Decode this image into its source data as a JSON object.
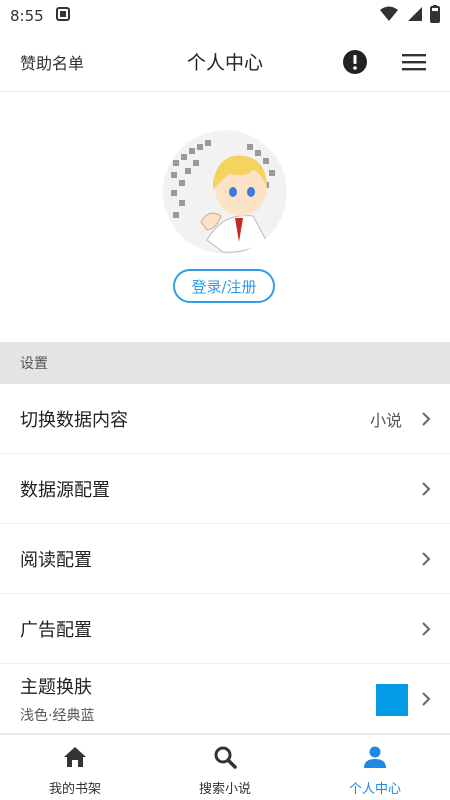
{
  "status_bar": {
    "time": "8:55",
    "icons": [
      "notification-icon",
      "wifi-icon",
      "signal-icon",
      "battery-icon"
    ]
  },
  "app_bar": {
    "sponsor_link": "赞助名单",
    "title": "个人中心",
    "icons": [
      "info-icon",
      "menu-icon"
    ]
  },
  "profile": {
    "avatar_icon": "avatar-anime-image",
    "login_label": "登录/注册"
  },
  "settings": {
    "section_title": "设置",
    "items": [
      {
        "label": "切换数据内容",
        "value": "小说"
      },
      {
        "label": "数据源配置",
        "value": ""
      },
      {
        "label": "阅读配置",
        "value": ""
      },
      {
        "label": "广告配置",
        "value": ""
      }
    ],
    "theme": {
      "label": "主题换肤",
      "sub": "浅色·经典蓝",
      "color": "#039be5"
    }
  },
  "bottom_nav": {
    "items": [
      {
        "label": "我的书架",
        "icon": "home-icon"
      },
      {
        "label": "搜索小说",
        "icon": "search-icon"
      },
      {
        "label": "个人中心",
        "icon": "person-icon"
      }
    ],
    "active_index": 2,
    "active_color": "#1e88e5"
  }
}
